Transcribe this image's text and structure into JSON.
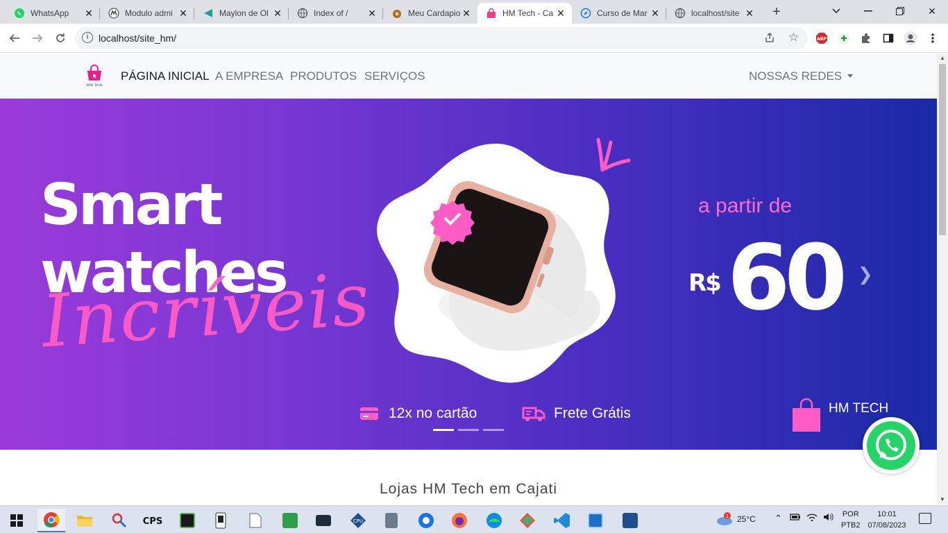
{
  "browser": {
    "tabs": [
      {
        "title": "WhatsApp",
        "icon": "whatsapp-icon"
      },
      {
        "title": "Modulo admi",
        "icon": "motorola-icon"
      },
      {
        "title": "Maylon de Ol",
        "icon": "play-icon"
      },
      {
        "title": "Index of /",
        "icon": "globe-icon"
      },
      {
        "title": "Meu Cardapio",
        "icon": "food-icon"
      },
      {
        "title": "HM Tech - Ca",
        "icon": "bag-icon"
      },
      {
        "title": "Curso de Mar",
        "icon": "compass-icon"
      },
      {
        "title": "localhost/site",
        "icon": "globe-icon"
      }
    ],
    "active_tab": 5,
    "url": "localhost/site_hm/",
    "extensions": [
      "ABP",
      "+"
    ]
  },
  "site": {
    "nav": {
      "items": [
        "PÁGINA INICIAL",
        "A EMPRESA",
        "PRODUTOS",
        "SERVIÇOS"
      ],
      "dropdown": "NOSSAS REDES"
    },
    "hero": {
      "line1": "Smart",
      "line2": "watches",
      "script": "Incríveis",
      "price_prefix": "a partir de",
      "currency": "R$",
      "price": "60",
      "features": [
        "12x no cartão",
        "Frete Grátis"
      ],
      "brand": "HM TECH",
      "slides": 3,
      "active_slide": 0
    },
    "section_title": "Lojas HM Tech em Cajati"
  },
  "taskbar": {
    "weather": "25°C",
    "weather_badge": "1",
    "lang": [
      "POR",
      "PTB2"
    ],
    "time": "10:01",
    "date": "07/08/2023"
  },
  "colors": {
    "hero_start": "#9a3ad9",
    "hero_end": "#1a2aa6",
    "accent_pink": "#ff5cc6",
    "whatsapp": "#25d366"
  }
}
